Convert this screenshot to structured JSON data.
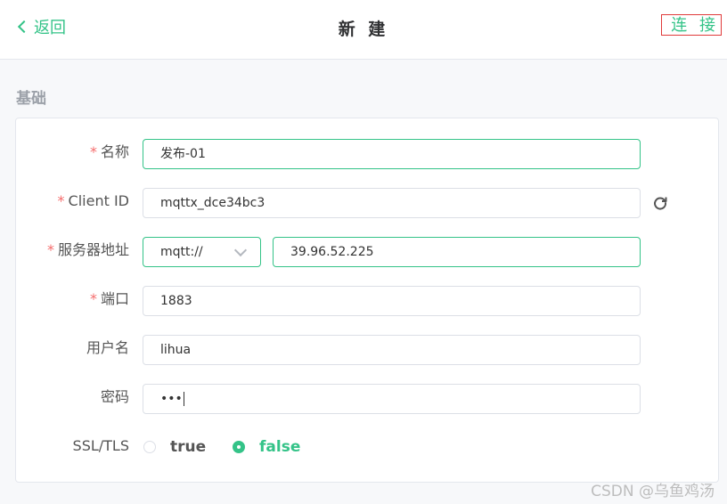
{
  "header": {
    "back_label": "返回",
    "title": "新 建",
    "connect_label": "连 接"
  },
  "section": {
    "title": "基础"
  },
  "form": {
    "required_mark": "*",
    "name": {
      "label": "名称",
      "value": "发布-01"
    },
    "client_id": {
      "label": "Client ID",
      "value": "mqttx_dce34bc3"
    },
    "host": {
      "label": "服务器地址",
      "protocol": "mqtt://",
      "value": "39.96.52.225"
    },
    "port": {
      "label": "端口",
      "value": "1883"
    },
    "username": {
      "label": "用户名",
      "value": "lihua"
    },
    "password": {
      "label": "密码",
      "value": "•••"
    },
    "ssl": {
      "label": "SSL/TLS",
      "option_true": "true",
      "option_false": "false",
      "selected": "false"
    }
  },
  "watermark": "CSDN @乌鱼鸡汤",
  "colors": {
    "accent": "#34c388",
    "required": "#f56c6c",
    "highlight_border": "#e03a3a"
  }
}
